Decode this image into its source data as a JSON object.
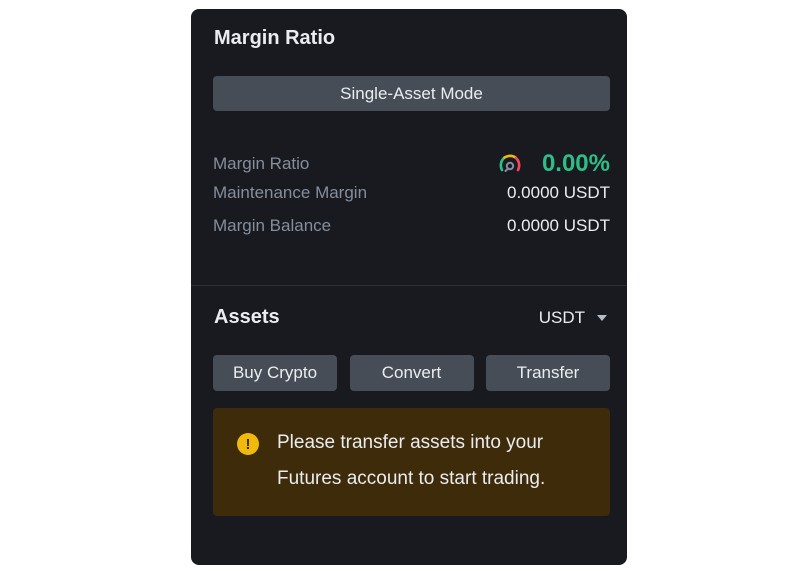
{
  "margin": {
    "title": "Margin Ratio",
    "mode_label": "Single-Asset Mode",
    "ratio_label": "Margin Ratio",
    "ratio_value": "0.00%",
    "maintenance_label": "Maintenance Margin",
    "maintenance_value": "0.0000 USDT",
    "balance_label": "Margin Balance",
    "balance_value": "0.0000 USDT",
    "ratio_icon": "gauge-icon"
  },
  "assets": {
    "title": "Assets",
    "currency": "USDT",
    "buttons": [
      "Buy Crypto",
      "Convert",
      "Transfer"
    ],
    "notice": "Please transfer assets into your Futures account to start trading.",
    "notice_icon": "warning-icon"
  },
  "colors": {
    "panel_bg": "#181a20",
    "positive": "#2ebd85",
    "warning": "#f0b90b",
    "notice_bg": "#3d2b0a",
    "button_bg": "#474d57"
  }
}
